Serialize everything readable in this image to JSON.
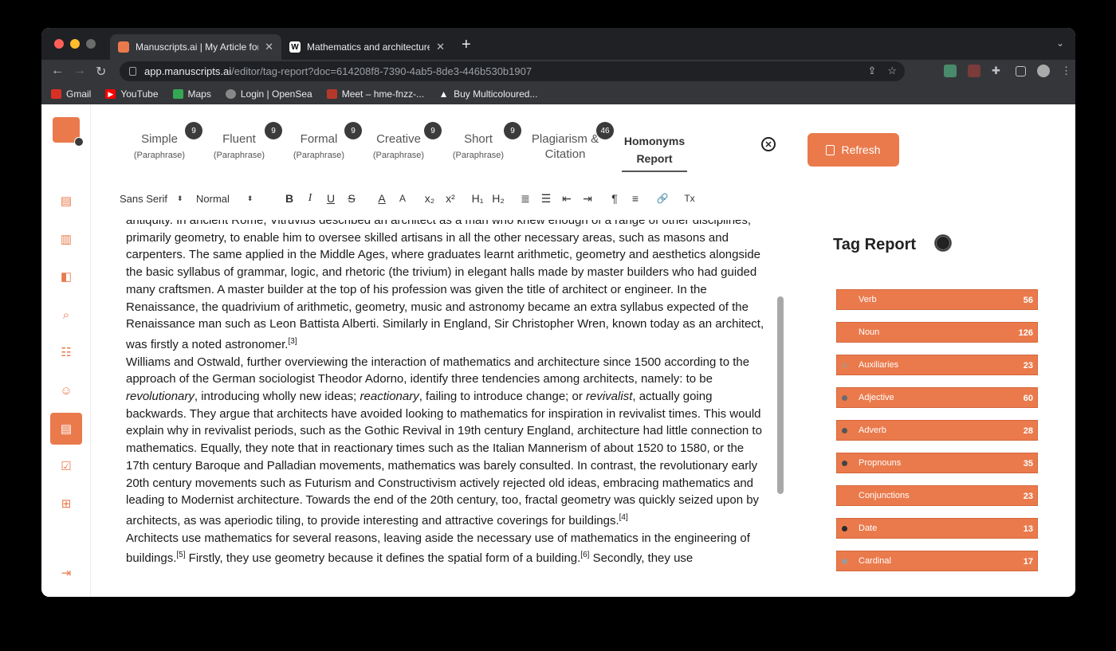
{
  "browser": {
    "tabs": [
      {
        "title": "Manuscripts.ai | My Article for",
        "icon": "manuscripts-icon",
        "active": true
      },
      {
        "title": "Mathematics and architecture",
        "icon": "wikipedia-icon",
        "active": false
      }
    ],
    "favicon_w": "W",
    "url_host": "app.manuscripts.ai",
    "url_path": "/editor/tag-report?doc=614208f8-7390-4ab5-8de3-446b530b1907",
    "bookmarks": [
      "Gmail",
      "YouTube",
      "Maps",
      "Login | OpenSea",
      "Meet – hme-fnzz-...",
      "Buy Multicoloured..."
    ]
  },
  "sidebar": {
    "items": [
      "ruler-icon",
      "chart-icon",
      "document-split-icon",
      "search-doc-icon",
      "list-icon",
      "smile-icon",
      "tag-report-icon",
      "checklist-icon",
      "add-apps-icon",
      "logout-icon"
    ],
    "active_index": 6
  },
  "modes": [
    {
      "label": "Simple",
      "sub": "(Paraphrase)",
      "badge": "9"
    },
    {
      "label": "Fluent",
      "sub": "(Paraphrase)",
      "badge": "9"
    },
    {
      "label": "Formal",
      "sub": "(Paraphrase)",
      "badge": "9"
    },
    {
      "label": "Creative",
      "sub": "(Paraphrase)",
      "badge": "9"
    },
    {
      "label": "Short",
      "sub": "(Paraphrase)",
      "badge": "9"
    },
    {
      "label": "Plagiarism &",
      "sub": "Citation",
      "badge": "46"
    }
  ],
  "homonyms": {
    "line1": "Homonyms",
    "line2": "Report"
  },
  "refresh_label": "Refresh",
  "format": {
    "font": "Sans Serif",
    "size": "Normal",
    "buttons": [
      "B",
      "I",
      "U",
      "S",
      "A",
      "A",
      "x₂",
      "x²",
      "H₁",
      "H₂",
      "≣",
      "☰",
      "⇤",
      "⇥",
      "¶",
      "≡",
      "🔗",
      "Tx"
    ]
  },
  "editor": {
    "p1": "antiquity. In ancient Rome, Vitruvius described an architect as a man who knew enough of a range of other disciplines, primarily geometry, to enable him to oversee skilled artisans in all the other necessary areas, such as masons and carpenters. The same applied in the Middle Ages, where graduates learnt arithmetic, geometry and aesthetics alongside the basic syllabus of grammar, logic, and rhetoric (the trivium) in elegant halls made by master builders who had guided many craftsmen. A master builder at the top of his profession was given the title of architect or engineer. In the Renaissance, the quadrivium of arithmetic, geometry, music and astronomy became an extra syllabus expected of the Renaissance man such as Leon Battista Alberti. Similarly in England, Sir Christopher Wren, known today as an architect, was firstly a noted astronomer.",
    "ref3": "[3]",
    "p2a": "Williams and Ostwald, further overviewing the interaction of mathematics and architecture since 1500 according to the approach of the German sociologist Theodor Adorno, identify three tendencies among architects, namely: to be ",
    "p2_rev": "revolutionary",
    "p2b": ", introducing wholly new ideas; ",
    "p2_react": "reactionary",
    "p2c": ", failing to introduce change; or ",
    "p2_revival": "revivalist",
    "p2d": ", actually going backwards. They argue that architects have avoided looking to mathematics for inspiration in revivalist times. This would explain why in revivalist periods, such as the Gothic Revival in 19th century England, architecture had little connection to mathematics. Equally, they note that in reactionary times such as the Italian Mannerism of about 1520 to 1580, or the 17th century Baroque and Palladian movements, mathematics was barely consulted. In contrast, the revolutionary early 20th century movements such as Futurism and Constructivism actively rejected old ideas, embracing mathematics and leading to Modernist architecture. Towards the end of the 20th century, too, fractal geometry was quickly seized upon by architects, as was aperiodic tiling, to provide interesting and attractive coverings for buildings.",
    "ref4": "[4]",
    "p3a": "Architects use mathematics for several reasons, leaving aside the necessary use of mathematics in the engineering of buildings.",
    "ref5": "[5]",
    "p3b": " Firstly, they use geometry because it defines the spatial form of a building.",
    "ref6": "[6]",
    "p3c": " Secondly, they use"
  },
  "tag_report": {
    "title": "Tag Report",
    "tags": [
      {
        "label": "Verb",
        "count": "56",
        "dot": "#ea7a4c"
      },
      {
        "label": "Noun",
        "count": "126",
        "dot": "#ea7a4c"
      },
      {
        "label": "Auxiliaries",
        "count": "23",
        "dot": "#c9886a"
      },
      {
        "label": "Adjective",
        "count": "60",
        "dot": "#6b6b6b"
      },
      {
        "label": "Adverb",
        "count": "28",
        "dot": "#555555"
      },
      {
        "label": "Propnouns",
        "count": "35",
        "dot": "#444444"
      },
      {
        "label": "Conjunctions",
        "count": "23",
        "dot": "#ea7a4c"
      },
      {
        "label": "Date",
        "count": "13",
        "dot": "#2b2b2b"
      },
      {
        "label": "Cardinal",
        "count": "17",
        "dot": "#9a9a9a"
      }
    ]
  }
}
